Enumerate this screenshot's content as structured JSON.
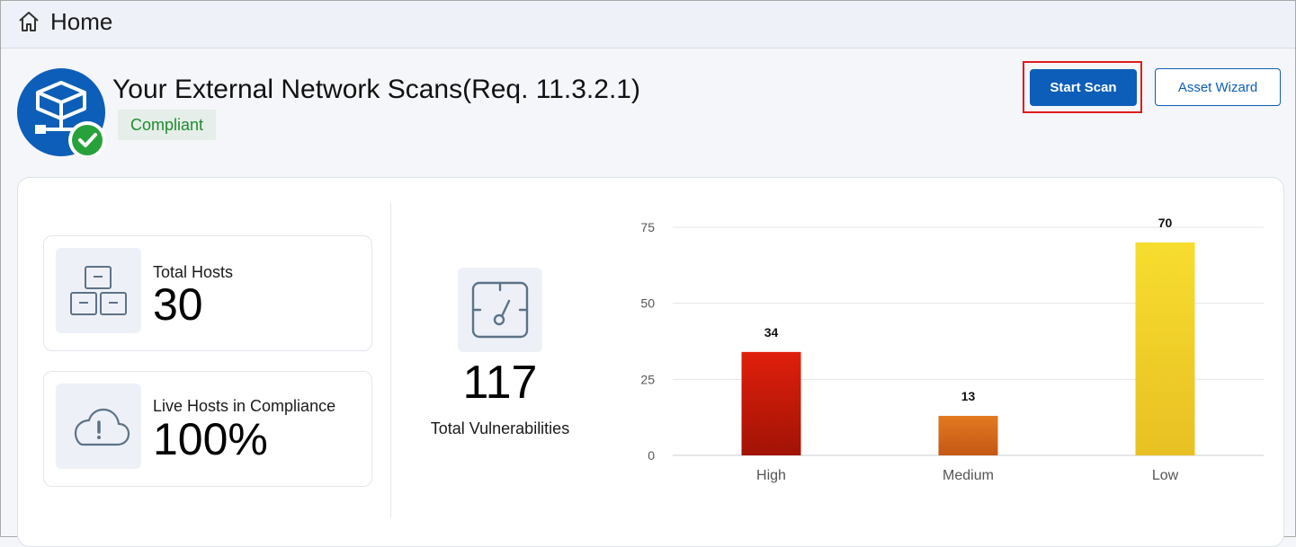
{
  "header": {
    "title": "Home",
    "icon": "home-icon"
  },
  "scan": {
    "title": "Your External Network Scans(Req. 11.3.2.1)",
    "status": "Compliant",
    "logo_icon": "network-scan-icon",
    "status_icon": "checkmark-icon"
  },
  "actions": {
    "start_scan": "Start Scan",
    "asset_wizard": "Asset Wizard"
  },
  "stats": {
    "total_hosts": {
      "label": "Total Hosts",
      "value": "30",
      "icon": "hosts-icon"
    },
    "live_hosts": {
      "label": "Live Hosts in Compliance",
      "value": "100%",
      "icon": "cloud-alert-icon"
    },
    "vulnerabilities": {
      "label": "Total Vulnerabilities",
      "value": "117",
      "icon": "gauge-icon"
    }
  },
  "colors": {
    "accent": "#0d5eb8",
    "compliant": "#1f8c30",
    "high": "#d91c0b",
    "medium": "#e0731b",
    "low": "#f5d62a"
  },
  "chart_data": {
    "type": "bar",
    "categories": [
      "High",
      "Medium",
      "Low"
    ],
    "values": [
      34,
      13,
      70
    ],
    "ylim": [
      0,
      75
    ],
    "yticks": [
      0,
      25,
      50,
      75
    ],
    "grid": true,
    "xlabel": "",
    "ylabel": "",
    "title": ""
  }
}
